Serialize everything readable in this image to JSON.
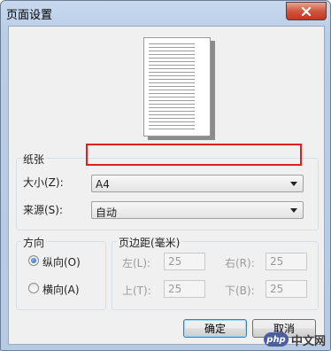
{
  "window": {
    "title": "页面设置",
    "close_icon": "close-icon"
  },
  "paper": {
    "group_label": "纸张",
    "size_label": "大小(Z):",
    "size_value": "A4",
    "source_label": "来源(S):",
    "source_value": "自动"
  },
  "orientation": {
    "group_label": "方向",
    "options": [
      {
        "label": "纵向(O)",
        "selected": true
      },
      {
        "label": "横向(A)",
        "selected": false
      }
    ]
  },
  "margins": {
    "group_label": "页边距(毫米)",
    "left_label": "左(L):",
    "left_value": "25",
    "right_label": "右(R):",
    "right_value": "25",
    "top_label": "上(T):",
    "top_value": "25",
    "bottom_label": "下(B):",
    "bottom_value": "25"
  },
  "buttons": {
    "ok": "确定",
    "cancel": "取消"
  },
  "watermark": {
    "badge": "php",
    "text": "中文网"
  },
  "colors": {
    "highlight_border": "#e02020",
    "accent": "#1f5fc7"
  }
}
